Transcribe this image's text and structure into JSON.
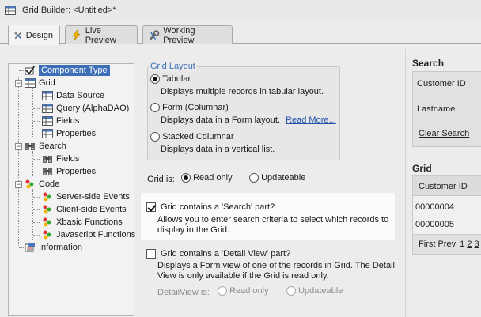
{
  "window": {
    "title": "Grid Builder: <Untitled>*"
  },
  "tabs": [
    {
      "label": "Design",
      "icon": "design-tools-icon",
      "active": true
    },
    {
      "label": "Live Preview",
      "icon": "lightning-icon",
      "active": false
    },
    {
      "label": "Working Preview",
      "icon": "wrench-icon",
      "active": false
    }
  ],
  "tree": {
    "component_type": "Component Type",
    "grid": "Grid",
    "data_source": "Data Source",
    "query": "Query (AlphaDAO)",
    "fields": "Fields",
    "properties": "Properties",
    "search": "Search",
    "search_fields": "Fields",
    "search_properties": "Properties",
    "code": "Code",
    "server_events": "Server-side Events",
    "client_events": "Client-side Events",
    "xbasic": "Xbasic Functions",
    "javascript": "Javascript Functions",
    "information": "Information"
  },
  "layout": {
    "group_label": "Grid Layout",
    "tabular": "Tabular",
    "tabular_desc": "Displays multiple records in tabular layout.",
    "form": "Form (Columnar)",
    "form_desc": "Displays data in a Form layout.",
    "read_more": "Read More...",
    "stacked": "Stacked Columnar",
    "stacked_desc": "Displays data in a vertical list."
  },
  "grid_is": {
    "label": "Grid is:",
    "read_only": "Read only",
    "updateable": "Updateable"
  },
  "search_part": {
    "label": "Grid contains a 'Search' part?",
    "desc1": "Allows you to enter search criteria to select which records to",
    "desc2": "display in the Grid.",
    "checked": true
  },
  "detail_part": {
    "label": "Grid contains a 'Detail View' part?",
    "desc1": "Displays a Form view of one of the records in Grid. The Detail",
    "desc2": "View is only available if the Grid is read only.",
    "detailview_label": "DetailView is:",
    "read_only": "Read only",
    "updateable": "Updateable",
    "checked": false
  },
  "preview": {
    "search_title": "Search",
    "customer_id": "Customer ID",
    "lastname": "Lastname",
    "clear_search": "Clear Search",
    "grid_title": "Grid",
    "col_header": "Customer ID",
    "rows": [
      "00000004",
      "00000005"
    ],
    "nav_first": "First",
    "nav_prev": "Prev",
    "page1": "1",
    "page2": "2",
    "page3": "3"
  }
}
